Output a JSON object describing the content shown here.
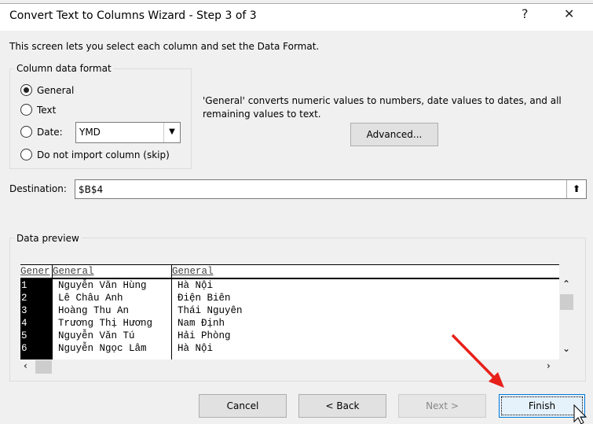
{
  "window": {
    "title": "Convert Text to Columns Wizard - Step 3 of 3",
    "help": "?",
    "close": "✕"
  },
  "intro": "This screen lets you select each column and set the Data Format.",
  "format": {
    "legend": "Column data format",
    "options": [
      {
        "label": "General",
        "selected": true
      },
      {
        "label": "Text",
        "selected": false
      },
      {
        "label": "Date:",
        "selected": false
      },
      {
        "label": "Do not import column (skip)",
        "selected": false
      }
    ],
    "date_value": "YMD"
  },
  "description": "'General' converts numeric values to numbers, date values to dates, and all remaining values to text.",
  "advanced_label": "Advanced...",
  "destination": {
    "label": "Destination:",
    "value": "$B$4"
  },
  "preview": {
    "legend": "Data preview",
    "headers": [
      "Gener",
      "General",
      "General"
    ],
    "rows": [
      [
        "1",
        "Nguyễn Văn Hùng",
        "Hà Nội"
      ],
      [
        "2",
        "Lê Châu Anh",
        "Điện Biên"
      ],
      [
        "3",
        "Hoàng Thu An",
        "Thái Nguyên"
      ],
      [
        "4",
        "Trương Thị Hương",
        "Nam Định"
      ],
      [
        "5",
        "Nguyễn Văn Tú",
        "Hải Phòng"
      ],
      [
        "6",
        "Nguyễn Ngọc Lâm",
        "Hà Nội"
      ]
    ]
  },
  "buttons": {
    "cancel": "Cancel",
    "back": "< Back",
    "next": "Next >",
    "finish": "Finish"
  },
  "colors": {
    "annotation_arrow": "#e8201a",
    "finish_border": "#0078d7",
    "finish_bg": "#e5f1fb"
  }
}
